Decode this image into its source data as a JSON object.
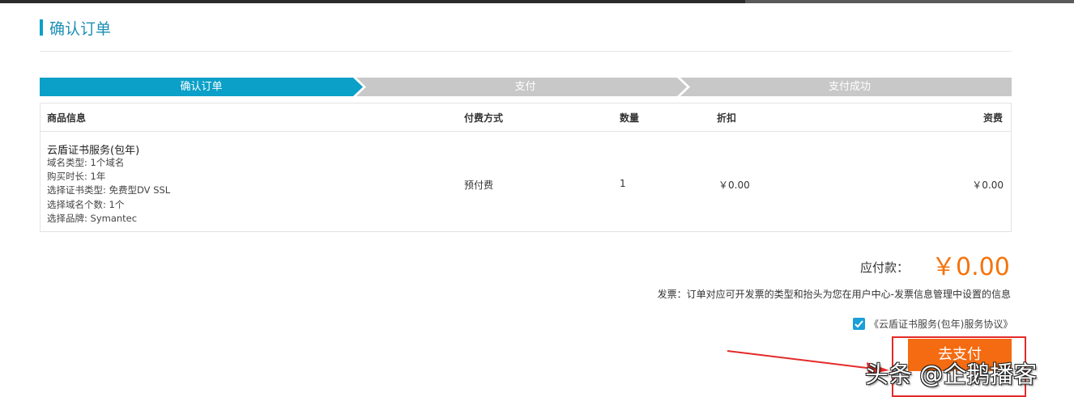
{
  "page": {
    "title": "确认订单"
  },
  "steps": [
    {
      "label": "确认订单",
      "state": "active"
    },
    {
      "label": "支付",
      "state": "inactive"
    },
    {
      "label": "支付成功",
      "state": "inactive"
    }
  ],
  "table": {
    "headers": {
      "product": "商品信息",
      "payment": "付费方式",
      "quantity": "数量",
      "discount": "折扣",
      "fee": "资费"
    },
    "row": {
      "product_name": "云盾证书服务(包年)",
      "details": [
        "域名类型: 1个域名",
        "购买时长: 1年",
        "选择证书类型: 免费型DV SSL",
        "选择域名个数: 1个",
        "选择品牌: Symantec"
      ],
      "payment": "预付费",
      "quantity": "1",
      "discount": "￥0.00",
      "fee": "￥0.00"
    }
  },
  "summary": {
    "pay_label": "应付款：",
    "pay_amount": "￥0.00",
    "invoice_note": "发票：订单对应可开发票的类型和抬头为您在用户中心-发票信息管理中设置的信息"
  },
  "agreement": {
    "checked": true,
    "label": "《云盾证书服务(包年)服务协议》"
  },
  "actions": {
    "pay_button": "去支付"
  },
  "watermark": "头条 @企鹅播客",
  "colors": {
    "accent": "#0aa0c8",
    "step_inactive": "#c8c8c8",
    "price": "#f5730b",
    "pay_button": "#f46b12",
    "annotation": "#e32a2a"
  }
}
